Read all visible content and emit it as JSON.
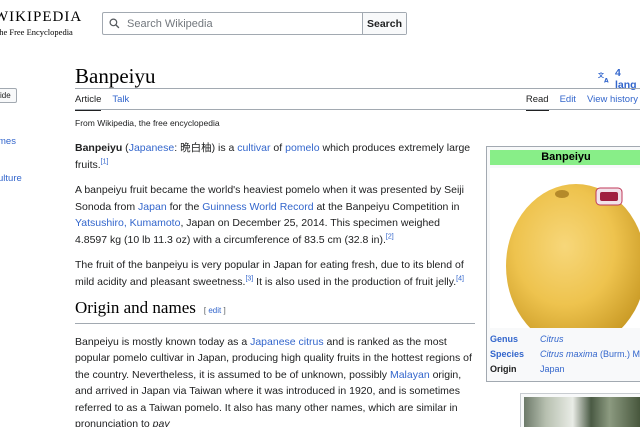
{
  "header": {
    "logo_wordmark": "WIKIPEDIA",
    "logo_tagline": "The Free Encyclopedia",
    "search_placeholder": "Search Wikipedia",
    "search_button": "Search"
  },
  "sidebar": {
    "hide_label": "ide",
    "links": [
      "mes",
      "ulture"
    ]
  },
  "page": {
    "title": "Banpeiyu",
    "languages": "4 lang",
    "tabs_left": [
      "Article",
      "Talk"
    ],
    "tabs_right": [
      "Read",
      "Edit",
      "View history"
    ],
    "from": "From Wikipedia, the free encyclopedia"
  },
  "content": {
    "p1": {
      "bold": "Banpeiyu",
      "open": " (",
      "link1": "Japanese",
      "mid1": ": 晩白柚) is a ",
      "link2": "cultivar",
      "mid2": " of ",
      "link3": "pomelo",
      "end": " which produces extremely large fruits.",
      "ref": "[1]"
    },
    "p2": {
      "t1": "A banpeiyu fruit became the world's heaviest pomelo when it was presented by Seiji Sonoda from ",
      "link1": "Japan",
      "t2": " for the ",
      "link2": "Guinness World Record",
      "t3": " at the Banpeiyu Competition in ",
      "link3": "Yatsushiro, Kumamoto",
      "t4": ", Japan on December 25, 2014. This specimen weighed 4.8597 kg (10 lb 11.3 oz) with a circumference of 83.5 cm (32.8 in).",
      "ref": "[2]"
    },
    "p3": {
      "t1": "The fruit of the banpeiyu is very popular in Japan for eating fresh, due to its blend of mild acidity and pleasant sweetness.",
      "ref1": "[3]",
      "t2": " It is also used in the production of fruit jelly.",
      "ref2": "[4]"
    },
    "section": {
      "heading": "Origin and names",
      "edit_open": "[ ",
      "edit": "edit",
      "edit_close": " ]"
    },
    "p4": {
      "t1": "Banpeiyu is mostly known today as a ",
      "link1": "Japanese citrus",
      "t2": " and is ranked as the most popular pomelo cultivar in Japan, producing high quality fruits in the hottest regions of the country. Nevertheless, it is assumed to be of unknown, possibly ",
      "link2": "Malayan",
      "t3": " origin, and arrived in Japan via Taiwan where it was introduced in 1920, and is sometimes referred to as a Taiwan pomelo. It also has many other names, which are similar in pronunciation to ",
      "italic": "pay"
    }
  },
  "infobox": {
    "title": "Banpeiyu",
    "header_color": "#88ee88",
    "rows": [
      {
        "key": "Genus",
        "value": "Citrus",
        "value_extra": ""
      },
      {
        "key": "Species",
        "value": "Citrus maxima",
        "value_extra": " (Burm.) M"
      },
      {
        "key": "Origin",
        "value": "Japan",
        "value_extra": ""
      }
    ]
  },
  "colors": {
    "link": "#3366cc",
    "text": "#202122",
    "border": "#a2a9b1"
  }
}
